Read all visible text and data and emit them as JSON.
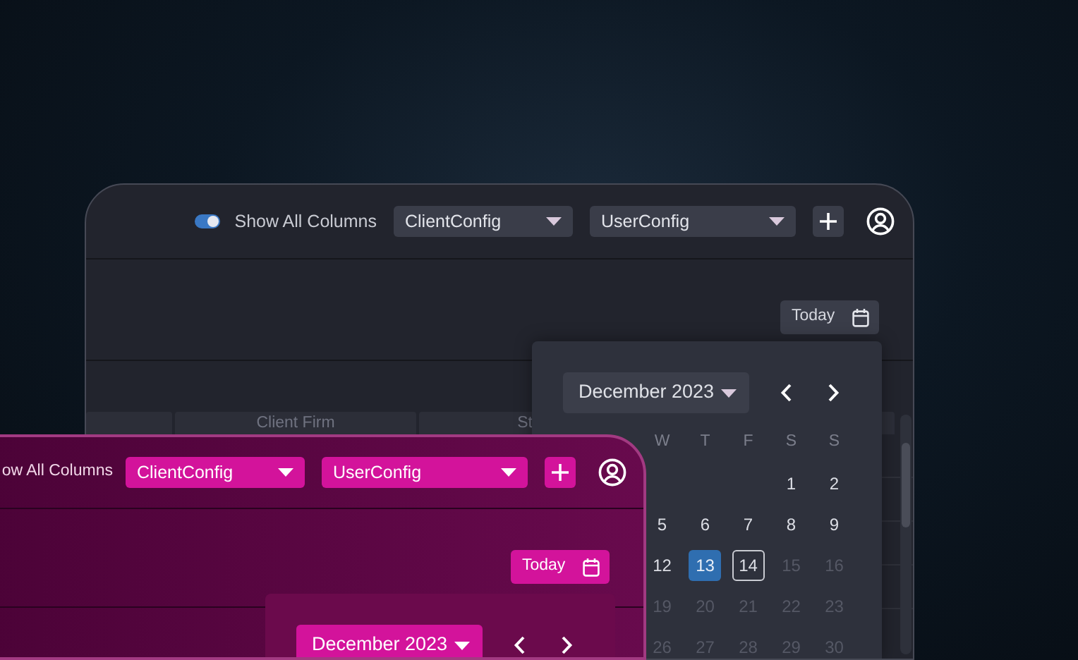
{
  "windows": [
    {
      "kind": "dark",
      "toolbar": {
        "toggle": {
          "on": true
        },
        "label": "Show All Columns",
        "selects": [
          {
            "value": "ClientConfig"
          },
          {
            "value": "UserConfig"
          }
        ]
      },
      "today_button": "Today",
      "table": {
        "columns": [
          "Client Firm",
          "St"
        ]
      },
      "calendar": {
        "month": "December 2023",
        "weekdays": [
          "W",
          "T",
          "F",
          "S",
          "S"
        ],
        "weeks": [
          {
            "days": [
              {
                "label": "1",
                "selected": false,
                "today": false,
                "disabled": false
              },
              {
                "label": "2",
                "selected": false,
                "today": false,
                "disabled": false
              }
            ]
          },
          {
            "days": [
              {
                "label": "5",
                "selected": false,
                "today": false,
                "disabled": false
              },
              {
                "label": "6",
                "selected": false,
                "today": false,
                "disabled": false
              },
              {
                "label": "7",
                "selected": false,
                "today": false,
                "disabled": false
              },
              {
                "label": "8",
                "selected": false,
                "today": false,
                "disabled": false
              },
              {
                "label": "9",
                "selected": false,
                "today": false,
                "disabled": false
              }
            ]
          },
          {
            "days": [
              {
                "label": "12",
                "selected": false,
                "today": false,
                "disabled": false
              },
              {
                "label": "13",
                "selected": true,
                "today": false,
                "disabled": false
              },
              {
                "label": "14",
                "selected": false,
                "today": true,
                "disabled": false
              },
              {
                "label": "15",
                "selected": false,
                "today": false,
                "disabled": true
              },
              {
                "label": "16",
                "selected": false,
                "today": false,
                "disabled": true
              }
            ]
          },
          {
            "days": [
              {
                "label": "19",
                "selected": false,
                "today": false,
                "disabled": true
              },
              {
                "label": "20",
                "selected": false,
                "today": false,
                "disabled": true
              },
              {
                "label": "21",
                "selected": false,
                "today": false,
                "disabled": true
              },
              {
                "label": "22",
                "selected": false,
                "today": false,
                "disabled": true
              },
              {
                "label": "23",
                "selected": false,
                "today": false,
                "disabled": true
              }
            ]
          },
          {
            "days": [
              {
                "label": "26",
                "selected": false,
                "today": false,
                "disabled": true
              },
              {
                "label": "27",
                "selected": false,
                "today": false,
                "disabled": true
              },
              {
                "label": "28",
                "selected": false,
                "today": false,
                "disabled": true
              },
              {
                "label": "29",
                "selected": false,
                "today": false,
                "disabled": true
              },
              {
                "label": "30",
                "selected": false,
                "today": false,
                "disabled": true
              }
            ]
          }
        ]
      }
    },
    {
      "kind": "pink",
      "toolbar": {
        "label": "ow All Columns",
        "selects": [
          {
            "value": "ClientConfig"
          },
          {
            "value": "UserConfig"
          }
        ]
      },
      "today_button": "Today",
      "calendar": {
        "month": "December 2023"
      }
    }
  ]
}
